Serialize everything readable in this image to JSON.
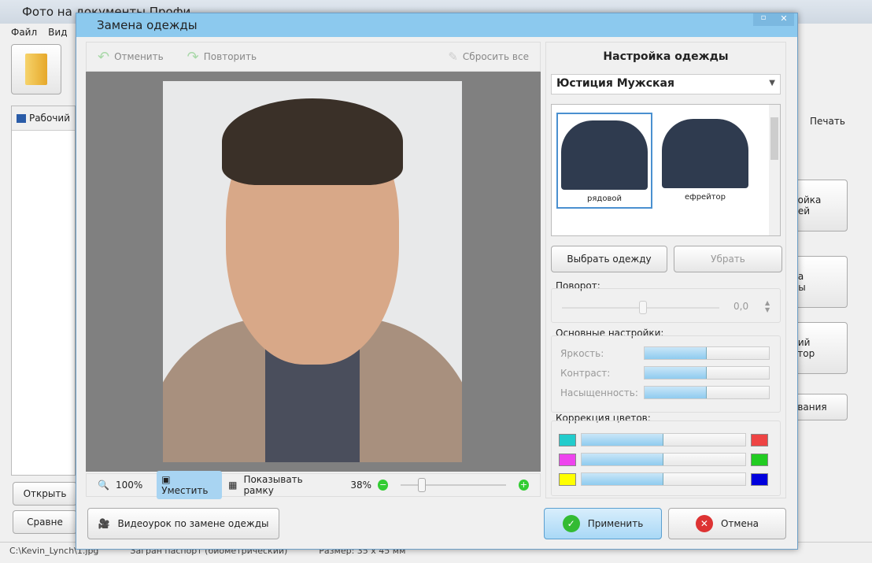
{
  "main_window": {
    "title": "Фото на документы Профи",
    "menu": [
      "Файл",
      "Вид"
    ],
    "tab_left": "Рабочий",
    "tab_right": "Печать",
    "right_buttons": [
      "ройка\nней",
      "на\nды",
      "ний\nктор",
      "ования"
    ],
    "left_buttons": [
      "Открыть",
      "Сравне"
    ],
    "status": [
      "C:\\Kevin_Lynch\\1.jpg",
      "Загран паспорт (биометрический)",
      "Размер: 35 x 45 мм"
    ]
  },
  "dialog": {
    "title": "Замена одежды",
    "toolbar": {
      "undo": "Отменить",
      "redo": "Повторить",
      "reset": "Сбросить все"
    },
    "bottom_bar": {
      "zoom_100": "100%",
      "fit": "Уместить",
      "show_frame": "Показывать рамку",
      "zoom_level": "38%",
      "zoom_value": 38
    },
    "video_button": "Видеоурок по замене одежды",
    "apply": "Применить",
    "cancel": "Отмена",
    "settings": {
      "heading": "Настройка одежды",
      "category": "Юстиция Мужская",
      "items": [
        {
          "label": "рядовой",
          "selected": true
        },
        {
          "label": "ефрейтор",
          "selected": false
        }
      ],
      "choose": "Выбрать одежду",
      "remove": "Убрать",
      "rotation": {
        "label": "Поворот:",
        "value": "0,0"
      },
      "basic": {
        "label": "Основные настройки:",
        "sliders": [
          {
            "name": "Яркость:",
            "value": 50
          },
          {
            "name": "Контраст:",
            "value": 50
          },
          {
            "name": "Насыщенность:",
            "value": 50
          }
        ]
      },
      "color": {
        "label": "Коррекция цветов:",
        "rows": [
          {
            "left": "#22cccc",
            "right": "#ee4444",
            "value": 50
          },
          {
            "left": "#ee44ee",
            "right": "#22cc22",
            "value": 50
          },
          {
            "left": "#ffff00",
            "right": "#0000dd",
            "value": 50
          }
        ]
      }
    }
  }
}
